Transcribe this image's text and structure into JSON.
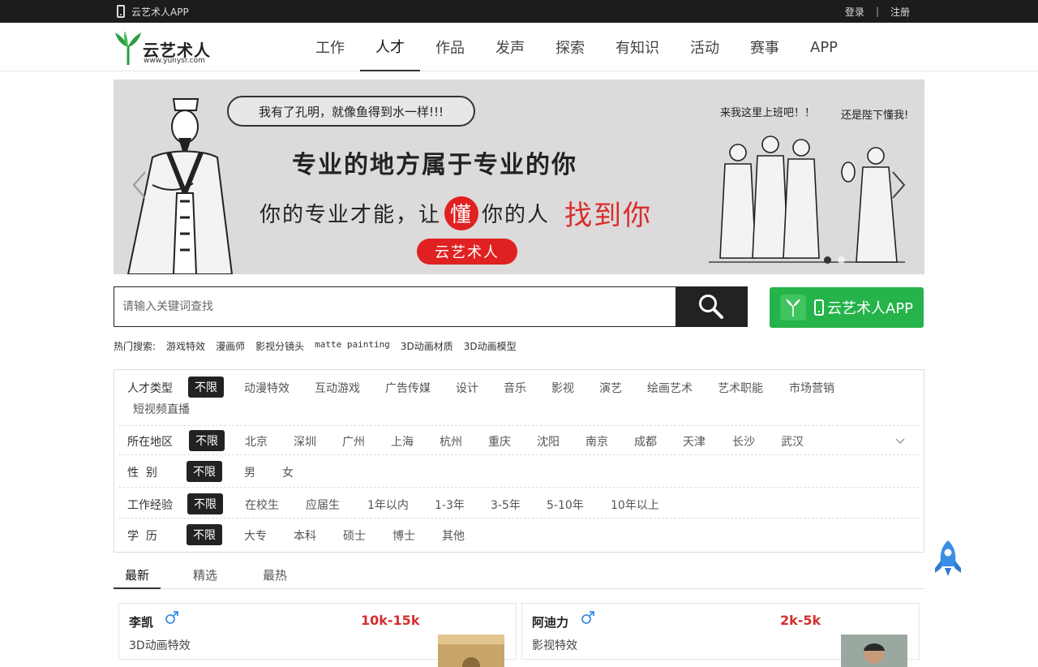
{
  "topbar": {
    "app_link": "云艺术人APP",
    "login": "登录",
    "separator": "|",
    "register": "注册"
  },
  "logo": {
    "name": "云艺术人",
    "url": "www.yunysr.com"
  },
  "nav": [
    "工作",
    "人才",
    "作品",
    "发声",
    "探索",
    "有知识",
    "活动",
    "赛事",
    "APP"
  ],
  "nav_active": "人才",
  "banner": {
    "bubble": "我有了孔明，就像鱼得到水一样!!!",
    "headline": "专业的地方属于专业的你",
    "subline_a": "你的专业才能，让",
    "subline_dong": "懂",
    "subline_b": "你的人",
    "subline_find": "找到你",
    "pill": "云艺术人",
    "caption_left": "来我这里上班吧！！",
    "caption_right": "还是陛下懂我!"
  },
  "search": {
    "placeholder": "请输入关键词查找"
  },
  "app_button": {
    "label": "云艺术人APP"
  },
  "hot": {
    "label": "热门搜索:",
    "items": [
      "游戏特效",
      "漫画师",
      "影视分镜头",
      "matte painting",
      "3D动画材质",
      "3D动画模型"
    ]
  },
  "filters": {
    "type": {
      "label": "人才类型",
      "options": [
        "不限",
        "动漫特效",
        "互动游戏",
        "广告传媒",
        "设计",
        "音乐",
        "影视",
        "演艺",
        "绘画艺术",
        "艺术职能",
        "市场营销",
        "短视频直播"
      ]
    },
    "region": {
      "label": "所在地区",
      "options": [
        "不限",
        "北京",
        "深圳",
        "广州",
        "上海",
        "杭州",
        "重庆",
        "沈阳",
        "南京",
        "成都",
        "天津",
        "长沙",
        "武汉"
      ]
    },
    "gender": {
      "label": "性  别",
      "options": [
        "不限",
        "男",
        "女"
      ]
    },
    "experience": {
      "label": "工作经验",
      "options": [
        "不限",
        "在校生",
        "应届生",
        "1年以内",
        "1-3年",
        "3-5年",
        "5-10年",
        "10年以上"
      ]
    },
    "education": {
      "label": "学  历",
      "options": [
        "不限",
        "大专",
        "本科",
        "硕士",
        "博士",
        "其他"
      ]
    }
  },
  "tabs": [
    "最新",
    "精选",
    "最热"
  ],
  "cards": [
    {
      "name": "李凯",
      "salary": "10k-15k",
      "role": "3D动画特效"
    },
    {
      "name": "阿迪力",
      "salary": "2k-5k",
      "role": "影视特效"
    }
  ],
  "colors": {
    "brand_green": "#25b34a",
    "accent_red": "#d32f2f",
    "dark": "#222222"
  }
}
